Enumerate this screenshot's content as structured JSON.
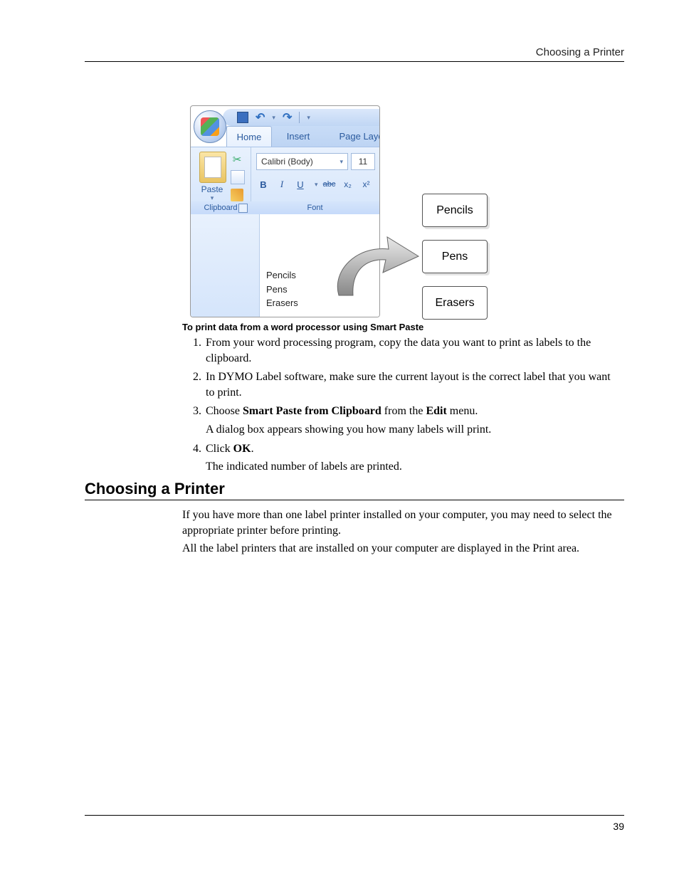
{
  "header": {
    "running_head": "Choosing a Printer"
  },
  "figure": {
    "qat": {
      "save": "save-icon",
      "undo": "undo-icon",
      "redo": "redo-icon",
      "customize": "customize-icon"
    },
    "tabs": {
      "home": "Home",
      "insert": "Insert",
      "page_layout": "Page Layout"
    },
    "clipboard": {
      "paste": "Paste",
      "group_label": "Clipboard"
    },
    "font": {
      "name": "Calibri (Body)",
      "size": "11",
      "group_label": "Font",
      "buttons": {
        "bold": "B",
        "italic": "I",
        "underline": "U",
        "strike": "abc",
        "subscript": "x₂",
        "superscript": "x²"
      }
    },
    "doc_lines": [
      "Pencils",
      "Pens",
      "Erasers"
    ],
    "labels": [
      "Pencils",
      "Pens",
      "Erasers"
    ]
  },
  "procedure": {
    "title": "To print data from a word processor using Smart Paste",
    "steps": [
      {
        "pre": "From your word processing program, copy the data you want to print as labels to the clipboard."
      },
      {
        "pre": "In DYMO Label software, make sure the current layout is the correct label that you want to print."
      },
      {
        "pre_a": "Choose ",
        "bold_a": "Smart Paste from Clipboard",
        "mid_a": " from the ",
        "bold_b": "Edit",
        "post_a": " menu.",
        "after": "A dialog box appears showing you how many labels will print."
      },
      {
        "pre_a": "Click ",
        "bold_a": "OK",
        "post_a": ".",
        "after": "The indicated number of labels are printed."
      }
    ]
  },
  "section": {
    "heading": "Choosing a Printer",
    "para1": "If you have more than one label printer installed on your computer, you may need to select the appropriate printer before printing.",
    "para2": "All the label printers that are installed on your computer are displayed in the Print area."
  },
  "footer": {
    "page": "39"
  }
}
